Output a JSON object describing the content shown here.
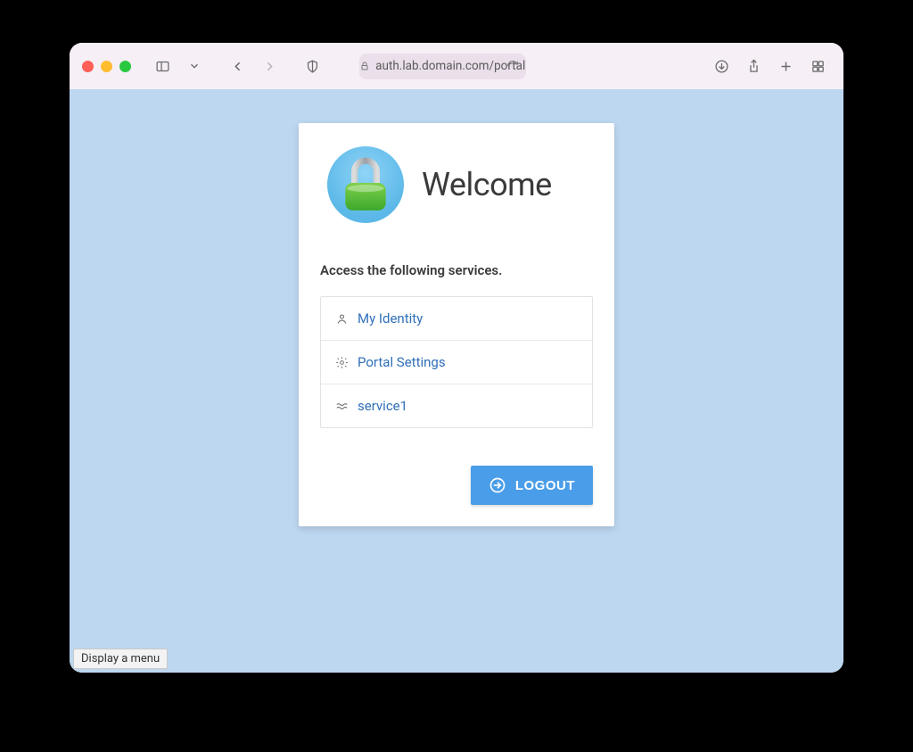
{
  "browser": {
    "url": "auth.lab.domain.com/portal",
    "tooltip": "Display a menu"
  },
  "card": {
    "title": "Welcome",
    "subtitle": "Access the following services.",
    "services": [
      {
        "label": "My Identity",
        "icon": "user-icon"
      },
      {
        "label": "Portal Settings",
        "icon": "gear-icon"
      },
      {
        "label": "service1",
        "icon": "waves-icon"
      }
    ],
    "logout_label": "LOGOUT"
  }
}
